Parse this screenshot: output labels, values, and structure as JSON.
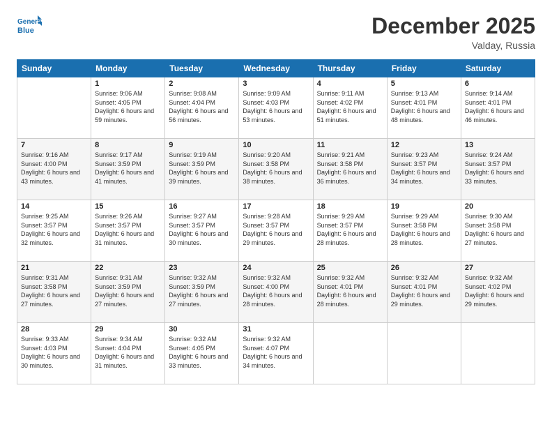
{
  "logo": {
    "line1": "General",
    "line2": "Blue"
  },
  "header": {
    "month": "December 2025",
    "location": "Valday, Russia"
  },
  "days_of_week": [
    "Sunday",
    "Monday",
    "Tuesday",
    "Wednesday",
    "Thursday",
    "Friday",
    "Saturday"
  ],
  "weeks": [
    [
      {
        "day": "",
        "info": ""
      },
      {
        "day": "1",
        "sunrise": "9:06 AM",
        "sunset": "4:05 PM",
        "daylight": "6 hours and 59 minutes."
      },
      {
        "day": "2",
        "sunrise": "9:08 AM",
        "sunset": "4:04 PM",
        "daylight": "6 hours and 56 minutes."
      },
      {
        "day": "3",
        "sunrise": "9:09 AM",
        "sunset": "4:03 PM",
        "daylight": "6 hours and 53 minutes."
      },
      {
        "day": "4",
        "sunrise": "9:11 AM",
        "sunset": "4:02 PM",
        "daylight": "6 hours and 51 minutes."
      },
      {
        "day": "5",
        "sunrise": "9:13 AM",
        "sunset": "4:01 PM",
        "daylight": "6 hours and 48 minutes."
      },
      {
        "day": "6",
        "sunrise": "9:14 AM",
        "sunset": "4:01 PM",
        "daylight": "6 hours and 46 minutes."
      }
    ],
    [
      {
        "day": "7",
        "sunrise": "9:16 AM",
        "sunset": "4:00 PM",
        "daylight": "6 hours and 43 minutes."
      },
      {
        "day": "8",
        "sunrise": "9:17 AM",
        "sunset": "3:59 PM",
        "daylight": "6 hours and 41 minutes."
      },
      {
        "day": "9",
        "sunrise": "9:19 AM",
        "sunset": "3:59 PM",
        "daylight": "6 hours and 39 minutes."
      },
      {
        "day": "10",
        "sunrise": "9:20 AM",
        "sunset": "3:58 PM",
        "daylight": "6 hours and 38 minutes."
      },
      {
        "day": "11",
        "sunrise": "9:21 AM",
        "sunset": "3:58 PM",
        "daylight": "6 hours and 36 minutes."
      },
      {
        "day": "12",
        "sunrise": "9:23 AM",
        "sunset": "3:57 PM",
        "daylight": "6 hours and 34 minutes."
      },
      {
        "day": "13",
        "sunrise": "9:24 AM",
        "sunset": "3:57 PM",
        "daylight": "6 hours and 33 minutes."
      }
    ],
    [
      {
        "day": "14",
        "sunrise": "9:25 AM",
        "sunset": "3:57 PM",
        "daylight": "6 hours and 32 minutes."
      },
      {
        "day": "15",
        "sunrise": "9:26 AM",
        "sunset": "3:57 PM",
        "daylight": "6 hours and 31 minutes."
      },
      {
        "day": "16",
        "sunrise": "9:27 AM",
        "sunset": "3:57 PM",
        "daylight": "6 hours and 30 minutes."
      },
      {
        "day": "17",
        "sunrise": "9:28 AM",
        "sunset": "3:57 PM",
        "daylight": "6 hours and 29 minutes."
      },
      {
        "day": "18",
        "sunrise": "9:29 AM",
        "sunset": "3:57 PM",
        "daylight": "6 hours and 28 minutes."
      },
      {
        "day": "19",
        "sunrise": "9:29 AM",
        "sunset": "3:58 PM",
        "daylight": "6 hours and 28 minutes."
      },
      {
        "day": "20",
        "sunrise": "9:30 AM",
        "sunset": "3:58 PM",
        "daylight": "6 hours and 27 minutes."
      }
    ],
    [
      {
        "day": "21",
        "sunrise": "9:31 AM",
        "sunset": "3:58 PM",
        "daylight": "6 hours and 27 minutes."
      },
      {
        "day": "22",
        "sunrise": "9:31 AM",
        "sunset": "3:59 PM",
        "daylight": "6 hours and 27 minutes."
      },
      {
        "day": "23",
        "sunrise": "9:32 AM",
        "sunset": "3:59 PM",
        "daylight": "6 hours and 27 minutes."
      },
      {
        "day": "24",
        "sunrise": "9:32 AM",
        "sunset": "4:00 PM",
        "daylight": "6 hours and 28 minutes."
      },
      {
        "day": "25",
        "sunrise": "9:32 AM",
        "sunset": "4:01 PM",
        "daylight": "6 hours and 28 minutes."
      },
      {
        "day": "26",
        "sunrise": "9:32 AM",
        "sunset": "4:01 PM",
        "daylight": "6 hours and 29 minutes."
      },
      {
        "day": "27",
        "sunrise": "9:32 AM",
        "sunset": "4:02 PM",
        "daylight": "6 hours and 29 minutes."
      }
    ],
    [
      {
        "day": "28",
        "sunrise": "9:33 AM",
        "sunset": "4:03 PM",
        "daylight": "6 hours and 30 minutes."
      },
      {
        "day": "29",
        "sunrise": "9:34 AM",
        "sunset": "4:04 PM",
        "daylight": "6 hours and 31 minutes."
      },
      {
        "day": "30",
        "sunrise": "9:32 AM",
        "sunset": "4:05 PM",
        "daylight": "6 hours and 33 minutes."
      },
      {
        "day": "31",
        "sunrise": "9:32 AM",
        "sunset": "4:07 PM",
        "daylight": "6 hours and 34 minutes."
      },
      {
        "day": "",
        "info": ""
      },
      {
        "day": "",
        "info": ""
      },
      {
        "day": "",
        "info": ""
      }
    ]
  ]
}
